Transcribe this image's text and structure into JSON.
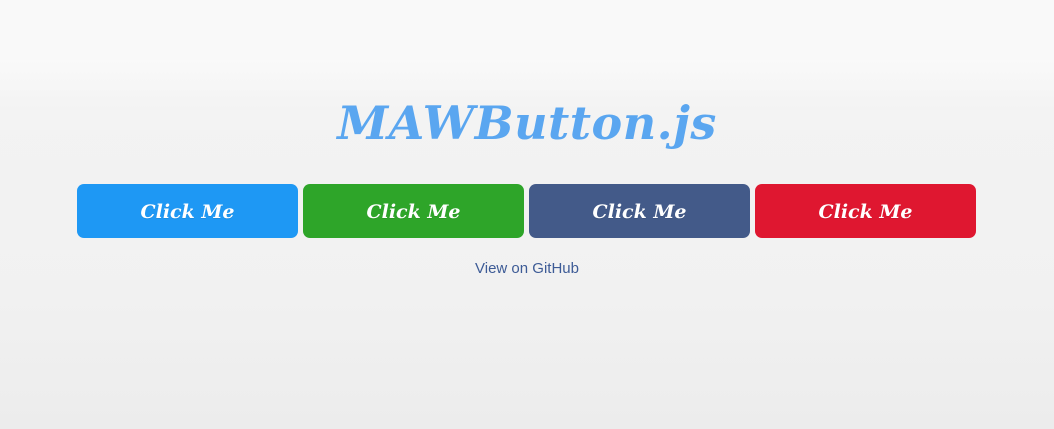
{
  "header": {
    "title": "MAWButton.js"
  },
  "buttons": [
    {
      "label": "Click Me",
      "color": "#1e98f4"
    },
    {
      "label": "Click Me",
      "color": "#2ea529"
    },
    {
      "label": "Click Me",
      "color": "#435a89"
    },
    {
      "label": "Click Me",
      "color": "#df1730"
    }
  ],
  "footer": {
    "github_link": "View on GitHub"
  },
  "colors": {
    "title": "#5aa6f0",
    "link": "#3d5b96"
  }
}
